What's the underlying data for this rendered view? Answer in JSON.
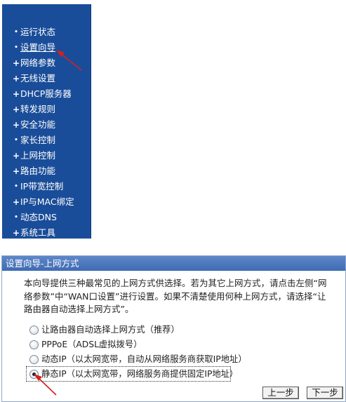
{
  "menu": {
    "items": [
      {
        "label": "运行状态",
        "bullet": "•"
      },
      {
        "label": "设置向导",
        "bullet": "•"
      },
      {
        "label": "网络参数",
        "bullet": "+"
      },
      {
        "label": "无线设置",
        "bullet": "+"
      },
      {
        "label": "DHCP服务器",
        "bullet": "+"
      },
      {
        "label": "转发规则",
        "bullet": "+"
      },
      {
        "label": "安全功能",
        "bullet": "+"
      },
      {
        "label": "家长控制",
        "bullet": "•"
      },
      {
        "label": "上网控制",
        "bullet": "+"
      },
      {
        "label": "路由功能",
        "bullet": "+"
      },
      {
        "label": "IP带宽控制",
        "bullet": "•"
      },
      {
        "label": "IP与MAC绑定",
        "bullet": "+"
      },
      {
        "label": "动态DNS",
        "bullet": "•"
      },
      {
        "label": "系统工具",
        "bullet": "+"
      }
    ]
  },
  "wizard": {
    "title": "设置向导-上网方式",
    "description": "本向导提供三种最常见的上网方式供选择。若为其它上网方式，请点击左侧“网络参数”中“WAN口设置”进行设置。如果不清楚使用何种上网方式，请选择“让路由器自动选择上网方式”。",
    "options": [
      {
        "label": "让路由器自动选择上网方式（推荐）",
        "checked": false
      },
      {
        "label": "PPPoE（ADSL虚拟拨号）",
        "checked": false
      },
      {
        "label": "动态IP（以太网宽带，自动从网络服务商获取IP地址）",
        "checked": false
      },
      {
        "label": "静态IP（以太网宽带，网络服务商提供固定IP地址）",
        "checked": true
      }
    ],
    "prev_label": "上一步",
    "next_label": "下一步"
  },
  "colors": {
    "menu_bg": "#1a4d99",
    "title_bar": "#4a77bd",
    "annotation": "#d42020"
  }
}
